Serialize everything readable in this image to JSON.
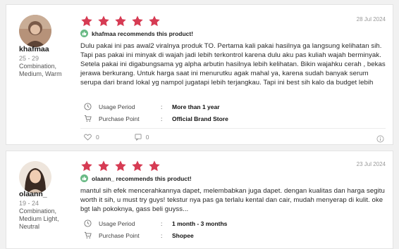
{
  "reviews": [
    {
      "username": "khafmaa",
      "age": "25 - 29",
      "skin": "Combination, Medium, Warm",
      "rating": 5,
      "date": "28 Jul 2024",
      "recommend": "khafmaa recommends this product!",
      "text": "Dulu pakai ini pas awal2 viralnya produk TO. Pertama kali pakai hasilnya ga langsung kelihatan sih. Tapi pas pakai ini minyak di wajah jadi lebih terkontrol karena dulu aku pas kuliah wajah berminyak. Setela pakai ini digabungsama yg alpha arbutin hasilnya lebih kelihatan. Bikin wajahku cerah , bekas jerawa berkurang. Untuk harga saat ini menurutku agak mahal ya, karena sudah banyak serum serupa dari brand lokal yg nampol jugatapi lebih terjangkau. Tapi ini best sih kalo da budget lebih",
      "usage_label": "Usage Period",
      "usage_value": "More than 1 year",
      "purchase_label": "Purchase Point",
      "purchase_value": "Official Brand Store",
      "likes": "0",
      "comments": "0"
    },
    {
      "username": "olaann_",
      "age": "19 - 24",
      "skin": "Combination, Medium Light, Neutral",
      "rating": 5,
      "date": "23 Jul 2024",
      "recommend": "olaann_ recommends this product!",
      "text": "mantul sih efek mencerahkannya dapet, melembabkan juga dapet. dengan kualitas dan harga segitu worth it sih, u must try guys! tekstur nya pas ga terlalu kental dan cair, mudah menyerap di kulit. oke bgt lah pokoknya, gass beli guyss...",
      "usage_label": "Usage Period",
      "usage_value": "1 month - 3 months",
      "purchase_label": "Purchase Point",
      "purchase_value": "Shopee"
    }
  ],
  "colors": {
    "star": "#d63b53",
    "recommend": "#68b984"
  },
  "icons": {
    "clock": "clock-icon",
    "cart": "cart-icon",
    "heart": "heart-icon",
    "comment": "comment-icon",
    "info": "info-icon",
    "recommend": "thumbs-up-icon"
  }
}
